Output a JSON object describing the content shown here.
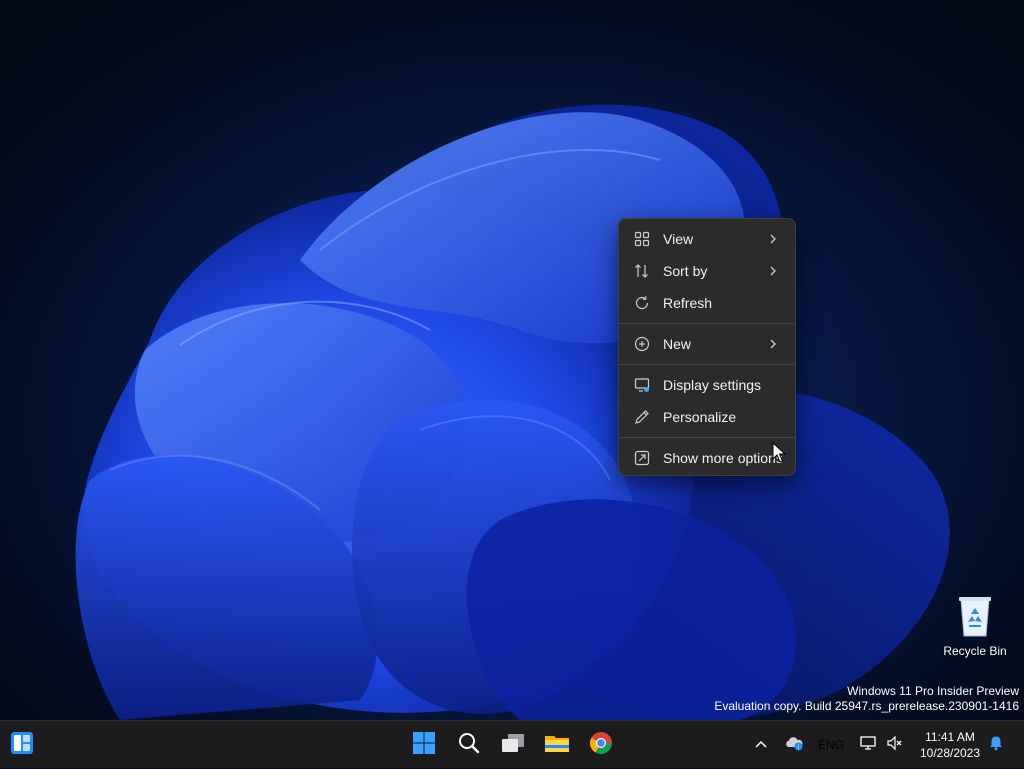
{
  "context_menu": {
    "items": [
      {
        "label": "View",
        "icon": "grid-view-icon",
        "has_submenu": true
      },
      {
        "label": "Sort by",
        "icon": "sort-arrows-icon",
        "has_submenu": true
      },
      {
        "label": "Refresh",
        "icon": "refresh-icon",
        "has_submenu": false
      },
      {
        "label": "New",
        "icon": "plus-circle-icon",
        "has_submenu": true
      },
      {
        "label": "Display settings",
        "icon": "display-settings-icon",
        "has_submenu": false
      },
      {
        "label": "Personalize",
        "icon": "pen-icon",
        "has_submenu": false
      },
      {
        "label": "Show more options",
        "icon": "expand-icon",
        "has_submenu": false
      }
    ]
  },
  "desktop": {
    "recycle_bin_label": "Recycle Bin"
  },
  "watermark": {
    "line1": "Windows 11 Pro Insider Preview",
    "line2": "Evaluation copy. Build 25947.rs_prerelease.230901-1416"
  },
  "taskbar": {
    "pinned": [
      {
        "name": "widgets-icon"
      },
      {
        "name": "start-icon"
      },
      {
        "name": "search-icon"
      },
      {
        "name": "task-view-icon"
      },
      {
        "name": "file-explorer-icon"
      },
      {
        "name": "chrome-icon"
      }
    ],
    "tray": {
      "language": "ENG",
      "time": "11:41 AM",
      "date": "10/28/2023"
    }
  },
  "colors": {
    "accent": "#0078d4",
    "menu_bg": "#2b2b2b",
    "taskbar_bg": "#1c1c1c"
  }
}
